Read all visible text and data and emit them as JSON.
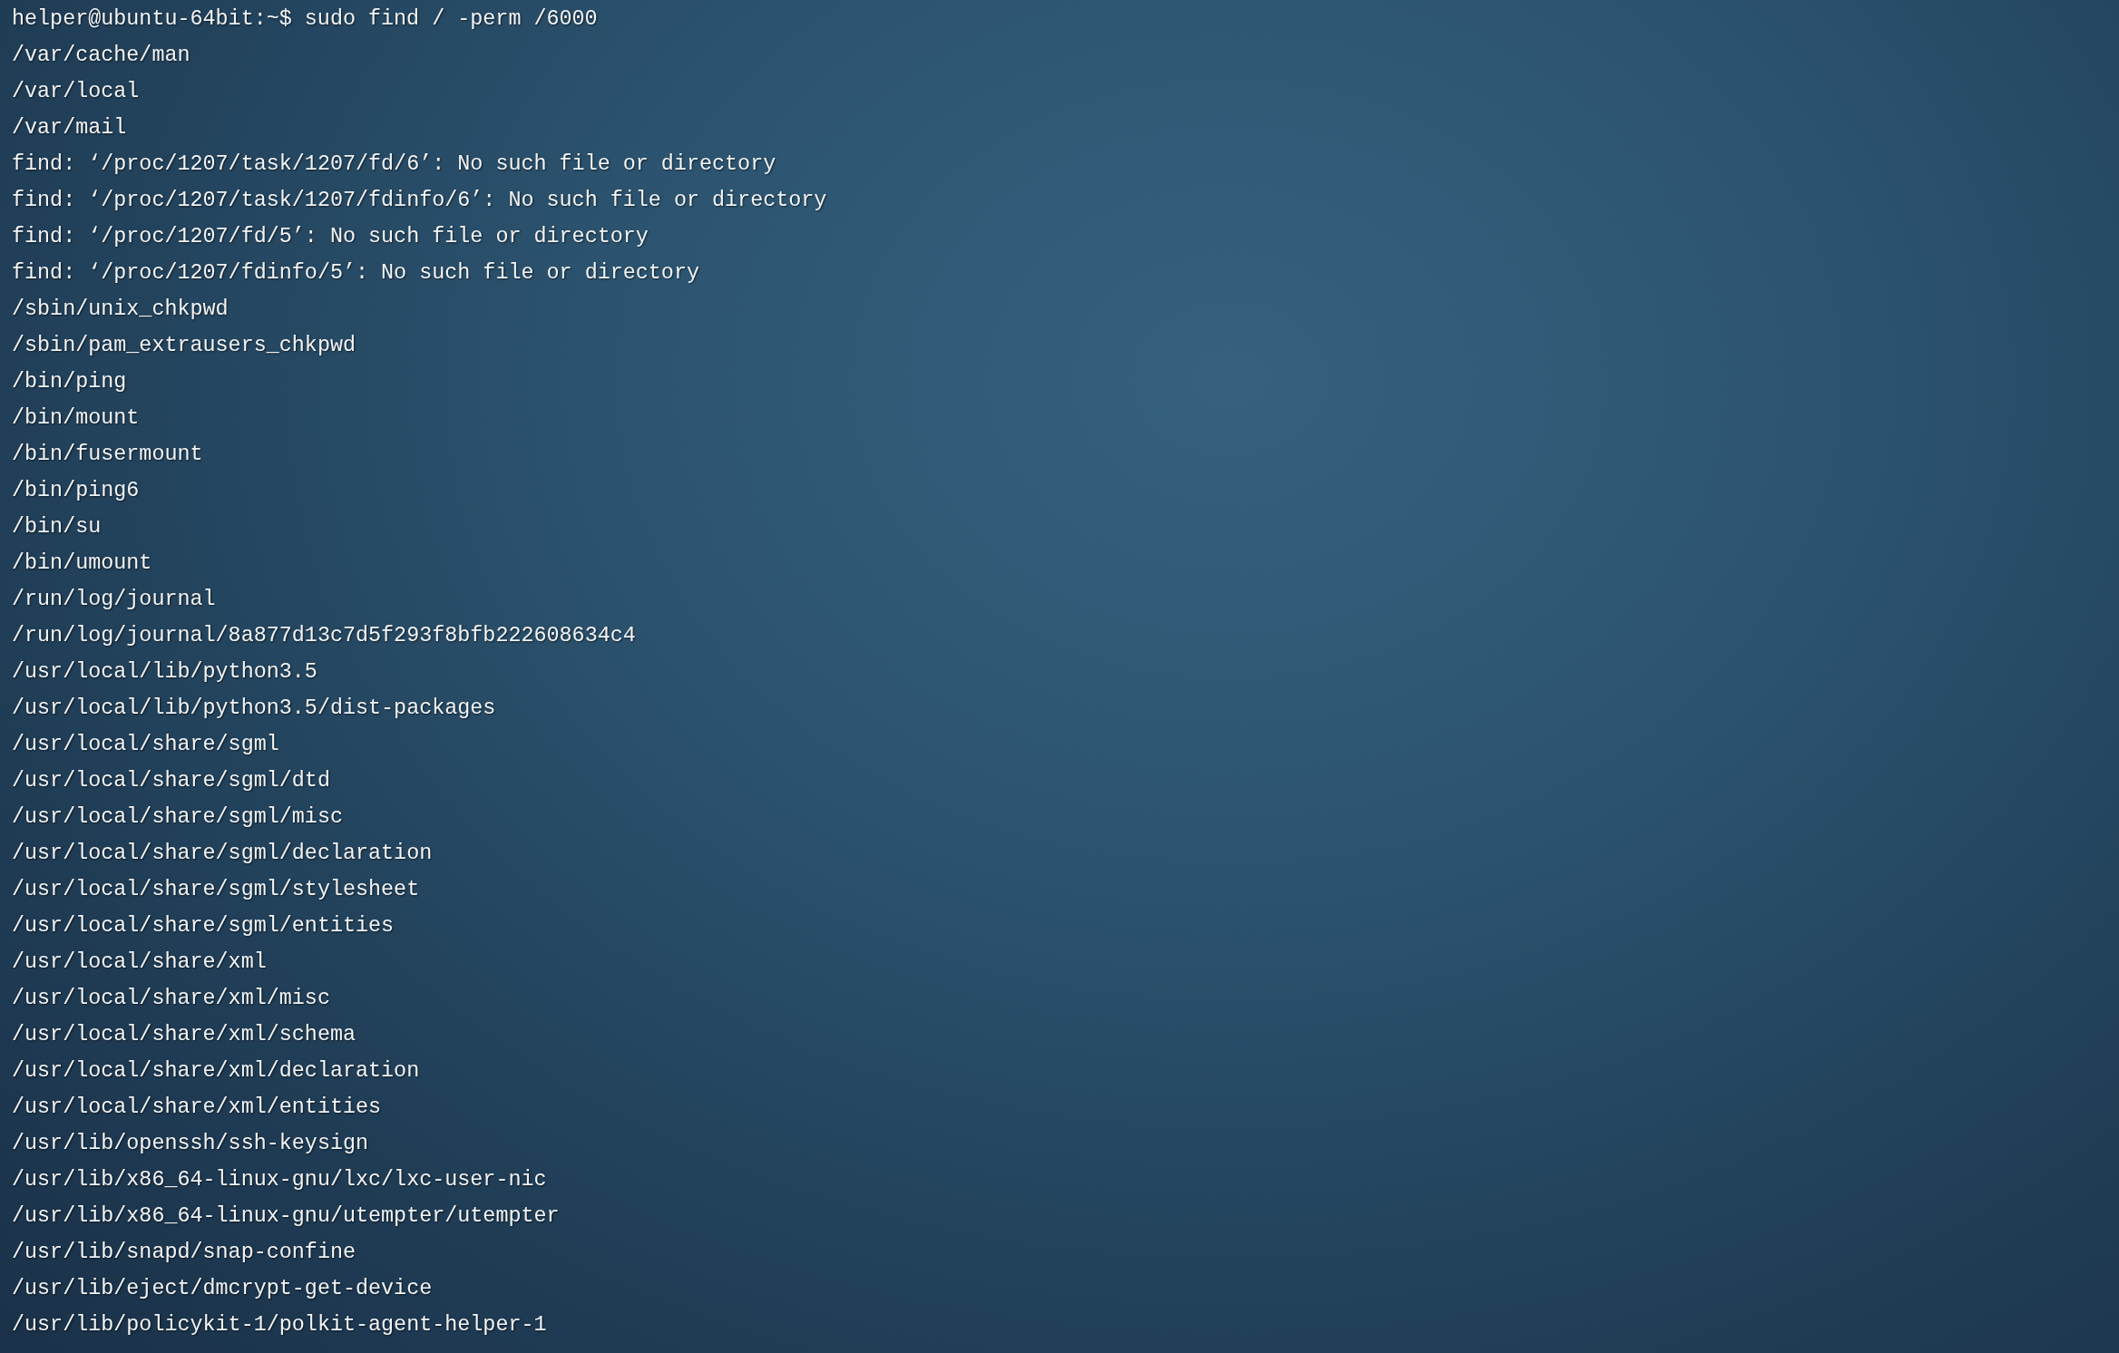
{
  "terminal": {
    "prompt": "helper@ubuntu-64bit:~$",
    "command": "sudo find / -perm /6000",
    "output": [
      "/var/cache/man",
      "/var/local",
      "/var/mail",
      "find: ‘/proc/1207/task/1207/fd/6’: No such file or directory",
      "find: ‘/proc/1207/task/1207/fdinfo/6’: No such file or directory",
      "find: ‘/proc/1207/fd/5’: No such file or directory",
      "find: ‘/proc/1207/fdinfo/5’: No such file or directory",
      "/sbin/unix_chkpwd",
      "/sbin/pam_extrausers_chkpwd",
      "/bin/ping",
      "/bin/mount",
      "/bin/fusermount",
      "/bin/ping6",
      "/bin/su",
      "/bin/umount",
      "/run/log/journal",
      "/run/log/journal/8a877d13c7d5f293f8bfb222608634c4",
      "/usr/local/lib/python3.5",
      "/usr/local/lib/python3.5/dist-packages",
      "/usr/local/share/sgml",
      "/usr/local/share/sgml/dtd",
      "/usr/local/share/sgml/misc",
      "/usr/local/share/sgml/declaration",
      "/usr/local/share/sgml/stylesheet",
      "/usr/local/share/sgml/entities",
      "/usr/local/share/xml",
      "/usr/local/share/xml/misc",
      "/usr/local/share/xml/schema",
      "/usr/local/share/xml/declaration",
      "/usr/local/share/xml/entities",
      "/usr/lib/openssh/ssh-keysign",
      "/usr/lib/x86_64-linux-gnu/lxc/lxc-user-nic",
      "/usr/lib/x86_64-linux-gnu/utempter/utempter",
      "/usr/lib/snapd/snap-confine",
      "/usr/lib/eject/dmcrypt-get-device",
      "/usr/lib/policykit-1/polkit-agent-helper-1"
    ]
  }
}
